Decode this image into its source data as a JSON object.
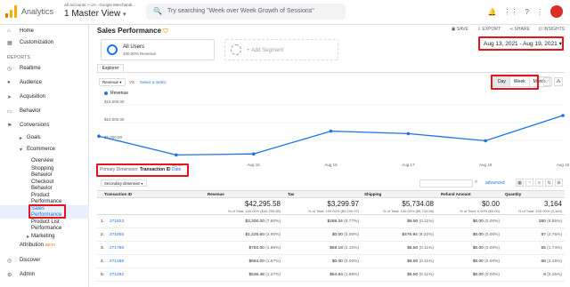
{
  "topbar": {
    "app_name": "Analytics",
    "account_path": "All accounts > UA - Google Merchandi...",
    "view_name": "1 Master View",
    "search_placeholder": "Try searching \"Week over Week Growth of Sessions\""
  },
  "sidebar": {
    "reports_header": "REPORTS",
    "items": [
      {
        "label": "Home",
        "icon": "home-icon"
      },
      {
        "label": "Customization",
        "icon": "customization-icon"
      },
      {
        "label": "Realtime",
        "icon": "realtime-icon"
      },
      {
        "label": "Audience",
        "icon": "audience-icon"
      },
      {
        "label": "Acquisition",
        "icon": "acquisition-icon"
      },
      {
        "label": "Behavior",
        "icon": "behavior-icon"
      },
      {
        "label": "Conversions",
        "icon": "conversions-icon"
      }
    ],
    "conversions_sub": [
      "Goals",
      "Ecommerce"
    ],
    "ecommerce_sub": [
      "Overview",
      "Shopping",
      "Behavior",
      "Checkout",
      "Behavior",
      "Product",
      "Performance",
      "Sales",
      "Performance",
      "Product List",
      "Performance",
      "Marketing"
    ],
    "attribution": "Attribution",
    "beta": "BETA",
    "discover": "Discover",
    "admin": "Admin"
  },
  "report": {
    "title": "Sales Performance",
    "actions": [
      "SAVE",
      "EXPORT",
      "SHARE",
      "INSIGHTS"
    ],
    "segment_name": "All Users",
    "segment_pct": "100.00% Revenue",
    "add_segment": "+ Add Segment",
    "date_range": "Aug 13, 2021 - Aug 19, 2021",
    "explorer_tab": "Explorer",
    "metric_select": "Revenue",
    "vs": "VS",
    "select_metric": "Select a metric",
    "granularity": [
      "Day",
      "Week",
      "Month"
    ],
    "legend": "Revenue"
  },
  "chart_data": {
    "type": "line",
    "x": [
      "Aug 13",
      "Aug 14",
      "Aug 15",
      "Aug 16",
      "Aug 17",
      "Aug 18",
      "Aug 19"
    ],
    "series": [
      {
        "name": "Revenue",
        "values": [
          6200,
          900,
          1200,
          7600,
          6900,
          4900,
          12000
        ]
      }
    ],
    "ylim": [
      0,
      16000
    ],
    "yticks": [
      "$15,000.00",
      "$10,000.00",
      "$5,000.00"
    ],
    "xticks": [
      "Aug 14",
      "Aug 15",
      "Aug 16",
      "Aug 17",
      "Aug 18",
      "Aug 19"
    ],
    "color": "#1a73e8"
  },
  "dimension": {
    "label": "Primary Dimension:",
    "active": "Transaction ID",
    "other": "Date",
    "secondary": "Secondary dimension",
    "advanced": "advanced"
  },
  "table": {
    "headers": [
      "Transaction ID",
      "Revenue",
      "Tax",
      "Shipping",
      "Refund Amount",
      "Quantity"
    ],
    "totals": [
      {
        "value": "$42,295.58",
        "pct": "% of Total: 100.00% ($42,295.58)"
      },
      {
        "value": "$3,299.97",
        "pct": "% of Total: 100.00% ($3,299.97)"
      },
      {
        "value": "$5,734.08",
        "pct": "% of Total: 100.00% ($5,734.08)"
      },
      {
        "value": "$0.00",
        "pct": "% of Total: 0.00% ($0.00)"
      },
      {
        "value": "3,164",
        "pct": "% of Total: 100.00% (3,164)"
      }
    ],
    "rows": [
      {
        "idx": "1.",
        "id": "271823",
        "revenue": "$3,300.00",
        "revenue_pct": "(7.80%)",
        "tax": "$289.34",
        "tax_pct": "(8.77%)",
        "ship": "$6.50",
        "ship_pct": "(0.11%)",
        "refund": "$0.00",
        "refund_pct": "(0.00%)",
        "qty": "280",
        "qty_pct": "(8.85%)"
      },
      {
        "idx": "2.",
        "id": "271008",
        "revenue": "$1,225.60",
        "revenue_pct": "(2.90%)",
        "tax": "$0.00",
        "tax_pct": "(0.00%)",
        "ship": "$476.94",
        "ship_pct": "(8.32%)",
        "refund": "$0.00",
        "refund_pct": "(0.00%)",
        "qty": "87",
        "qty_pct": "(2.75%)"
      },
      {
        "idx": "3.",
        "id": "271788",
        "revenue": "$784.00",
        "revenue_pct": "(1.85%)",
        "tax": "$69.18",
        "tax_pct": "(2.10%)",
        "ship": "$6.50",
        "ship_pct": "(0.11%)",
        "refund": "$0.00",
        "refund_pct": "(0.00%)",
        "qty": "55",
        "qty_pct": "(1.74%)"
      },
      {
        "idx": "4.",
        "id": "271288",
        "revenue": "$664.00",
        "revenue_pct": "(1.57%)",
        "tax": "$0.00",
        "tax_pct": "(0.00%)",
        "ship": "$6.50",
        "ship_pct": "(0.11%)",
        "refund": "$0.00",
        "refund_pct": "(0.00%)",
        "qty": "68",
        "qty_pct": "(2.15%)"
      },
      {
        "idx": "5.",
        "id": "271282",
        "revenue": "$536.48",
        "revenue_pct": "(1.27%)",
        "tax": "$54.84",
        "tax_pct": "(1.66%)",
        "ship": "$6.50",
        "ship_pct": "(0.11%)",
        "refund": "$0.00",
        "refund_pct": "(0.00%)",
        "qty": "8",
        "qty_pct": "(0.25%)"
      }
    ]
  },
  "colors": {
    "accent": "#1a73e8",
    "highlight": "#e8141c",
    "brand": "#f9ab00"
  }
}
